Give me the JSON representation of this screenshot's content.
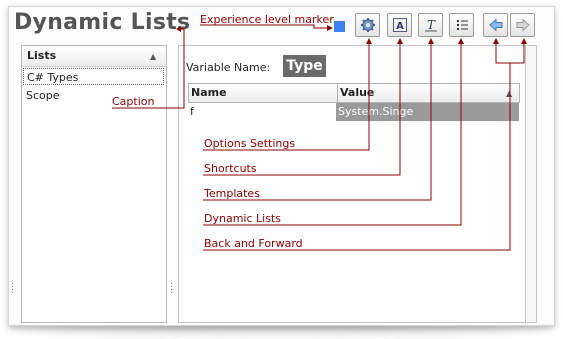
{
  "window": {
    "title": "Dynamic Lists"
  },
  "toolbar": {
    "buttons": [
      {
        "name": "options-settings",
        "icon": "gear-icon"
      },
      {
        "name": "shortcuts",
        "icon": "shortcut-a-icon"
      },
      {
        "name": "templates",
        "icon": "template-t-icon"
      },
      {
        "name": "dynamic-lists",
        "icon": "list-icon"
      },
      {
        "name": "back",
        "icon": "arrow-left-icon"
      },
      {
        "name": "forward",
        "icon": "arrow-right-icon"
      }
    ],
    "experience_marker_color": "#3b7ff0"
  },
  "lists_panel": {
    "header": "Lists",
    "items": [
      "C# Types",
      "Scope"
    ],
    "selected_index": 0
  },
  "editor": {
    "variable_name_label": "Variable Name:",
    "variable_type": "Type",
    "grid": {
      "columns": [
        "Name",
        "Value"
      ],
      "rows": [
        {
          "name": "f",
          "value": "System.Singe"
        }
      ]
    }
  },
  "callouts": {
    "experience_level_marker": "Experience level marker",
    "caption": "Caption",
    "options_settings": "Options Settings",
    "shortcuts": "Shortcuts",
    "templates": "Templates",
    "dynamic_lists": "Dynamic Lists",
    "back_and_forward": "Back and Forward"
  },
  "colors": {
    "callout": "#8b0000",
    "accent_blue": "#3b7ff0"
  }
}
